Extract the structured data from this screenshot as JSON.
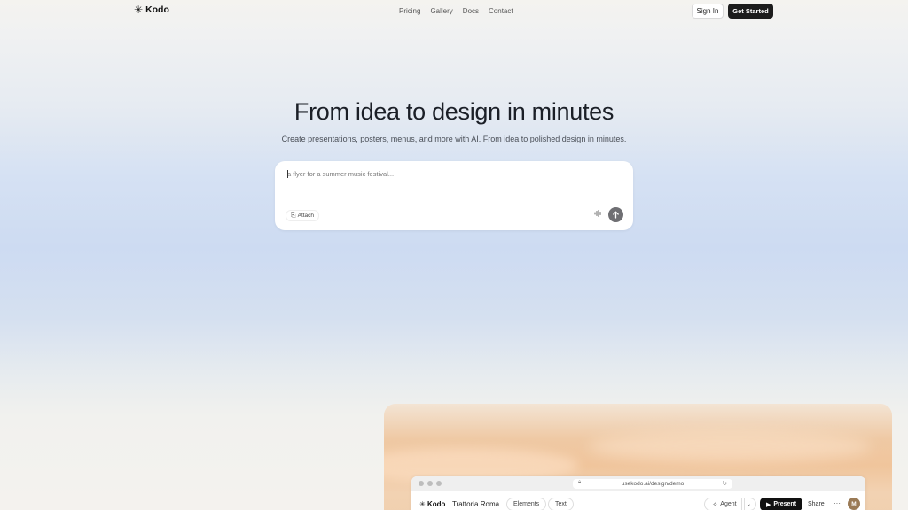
{
  "nav": {
    "logo_mark": "✳",
    "logo_text": "Kodo",
    "links": [
      "Pricing",
      "Gallery",
      "Docs",
      "Contact"
    ],
    "sign_in": "Sign In",
    "get_started": "Get Started"
  },
  "hero": {
    "title": "From idea to design in minutes",
    "subtitle": "Create presentations, posters, menus, and more with AI. From idea to polished design in minutes."
  },
  "prompt": {
    "placeholder": "a flyer for a summer music festival...",
    "attach_label": "Attach",
    "attach_icon": "paperclip-icon",
    "mic_icon": "waveform-icon",
    "send_icon": "arrow-up-icon"
  },
  "showcase": {
    "url": "usekodo.ai/design/demo",
    "app_logo": "Kodo",
    "project_name": "Trattoria Roma",
    "tabs": [
      "Elements",
      "Text"
    ],
    "agent_label": "Agent",
    "present_label": "Present",
    "share_label": "Share",
    "more_label": "···",
    "avatar_initial": "M"
  },
  "colors": {
    "accent_dark": "#1c1c1c",
    "send_button": "#6f6f73",
    "avatar": "#9a7a55"
  }
}
